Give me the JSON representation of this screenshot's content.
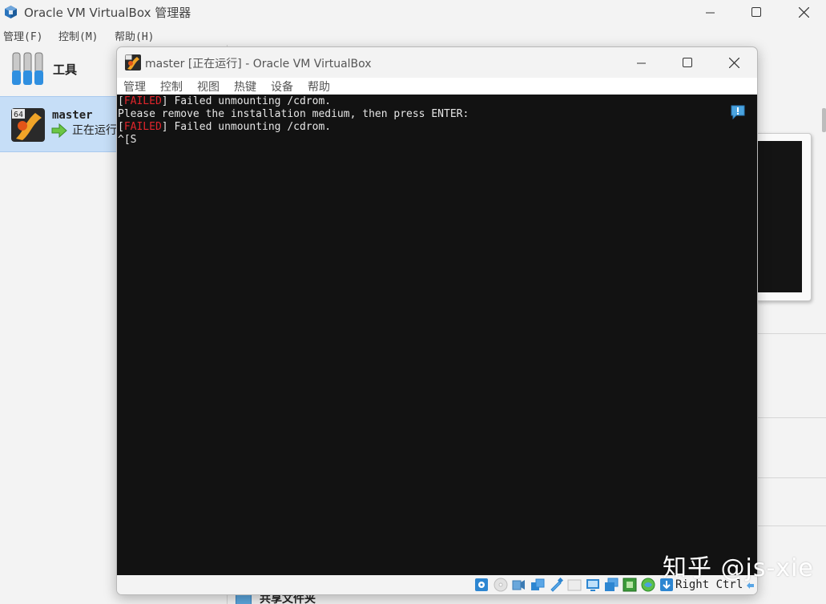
{
  "manager": {
    "title": "Oracle VM VirtualBox 管理器",
    "menu": [
      "管理(F)",
      "控制(M)",
      "帮助(H)"
    ],
    "sidebar": {
      "tools_label": "工具",
      "vm": {
        "name": "master",
        "os_badge": "64",
        "state": "正在运行"
      }
    },
    "details": {
      "shared_folders_label": "共享文件夹"
    }
  },
  "vm_window": {
    "title": "master [正在运行] - Oracle VM VirtualBox",
    "menu": [
      "管理",
      "控制",
      "视图",
      "热键",
      "设备",
      "帮助"
    ],
    "console": {
      "lines": [
        {
          "bracket_open": "[",
          "status": "FAILED",
          "bracket_close": "]",
          "text": " Failed unmounting /cdrom."
        },
        {
          "text": "Please remove the installation medium, then press ENTER:"
        },
        {
          "bracket_open": "[",
          "status": "FAILED",
          "bracket_close": "]",
          "text": " Failed unmounting /cdrom."
        },
        {
          "text": "^[S"
        }
      ]
    },
    "statusbar": {
      "icons": [
        "hard-disk-icon",
        "optical-drive-icon",
        "audio-icon",
        "network-icon",
        "usb-icon",
        "shared-folders-icon",
        "display-icon",
        "recording-icon",
        "cpu-icon",
        "mouse-integration-icon",
        "keyboard-capture-icon"
      ],
      "host_key": "Right Ctrl"
    }
  },
  "watermark": "知乎 @js-xie",
  "colors": {
    "failed": "#e0252b",
    "console_bg": "#121212",
    "console_fg": "#e6e6e6",
    "selection": "#c6def7"
  }
}
